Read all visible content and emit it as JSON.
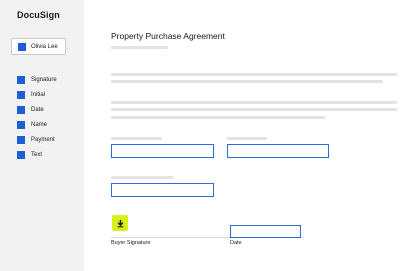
{
  "app": {
    "brand": "DocuSign"
  },
  "sidebar": {
    "signer": {
      "name": "Olivia Lee",
      "color": "#1f5fd6"
    },
    "fields": [
      {
        "label": "Signature",
        "icon": "square-icon"
      },
      {
        "label": "Initial",
        "icon": "square-icon"
      },
      {
        "label": "Date",
        "icon": "square-icon"
      },
      {
        "label": "Name",
        "icon": "square-icon"
      },
      {
        "label": "Payment",
        "icon": "square-icon"
      },
      {
        "label": "Text",
        "icon": "square-icon"
      }
    ]
  },
  "document": {
    "title": "Property Purchase Agreement",
    "signature_label": "Buyer Signature",
    "signature_icon": "download-arrow-icon",
    "date_label": "Date",
    "accent_color": "#2d6cd9",
    "signature_button_color": "#d7ef1a"
  }
}
